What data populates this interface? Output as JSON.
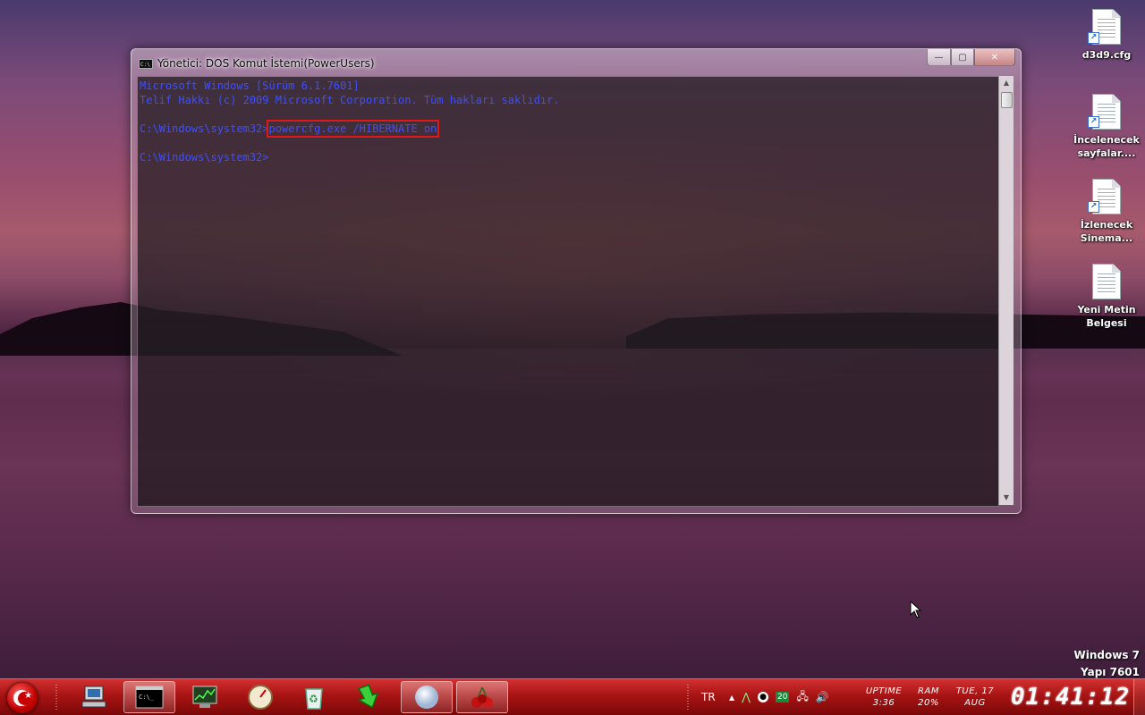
{
  "desktop": {
    "icons": [
      {
        "label": "d3d9.cfg",
        "shortcut": true
      },
      {
        "label": "İncelenecek sayfalar....",
        "shortcut": true
      },
      {
        "label": "İzlenecek Sinema...",
        "shortcut": true
      },
      {
        "label": "Yeni Metin Belgesi",
        "shortcut": false
      }
    ],
    "watermark": {
      "line1": "Windows 7",
      "line2": "Yapı 7601"
    }
  },
  "window": {
    "title": "Yönetici: DOS Komut İstemi(PowerUsers)",
    "icon_text": "C:\\",
    "controls": {
      "minimize": "—",
      "maximize": "▢",
      "close": "✕"
    },
    "console": {
      "line1": "Microsoft Windows [Sürüm 6.1.7601]",
      "line2": "Telif Hakkı (c) 2009 Microsoft Corporation. Tüm hakları saklıdır.",
      "line3": "",
      "prompt1": "C:\\Windows\\system32>",
      "command": "powercfg.exe /HIBERNATE on",
      "line5": "",
      "prompt2": "C:\\Windows\\system32>"
    },
    "highlight_color": "#e01818",
    "text_color": "#3c4fff"
  },
  "taskbar": {
    "pinned": [
      {
        "name": "computer",
        "icon": "computer-icon"
      },
      {
        "name": "command-prompt",
        "icon": "cmd-icon",
        "active": true
      },
      {
        "name": "task-manager",
        "icon": "monitor-chart-icon"
      },
      {
        "name": "speed-app",
        "icon": "gauge-icon"
      },
      {
        "name": "recycle",
        "icon": "recycle-bin-icon"
      },
      {
        "name": "downloader",
        "icon": "green-arrow-icon"
      },
      {
        "name": "sphere-app",
        "icon": "sphere-icon"
      },
      {
        "name": "cherry-app",
        "icon": "cherry-icon"
      }
    ],
    "tray": {
      "language": "TR",
      "expand": "▲",
      "badge": "20",
      "uptime_label": "UPTIME",
      "uptime_value": "3:36",
      "ram_label": "RAM",
      "ram_value": "20%",
      "date_day": "TUE, 17",
      "date_month": "AUG",
      "clock": "01:41:12"
    }
  }
}
